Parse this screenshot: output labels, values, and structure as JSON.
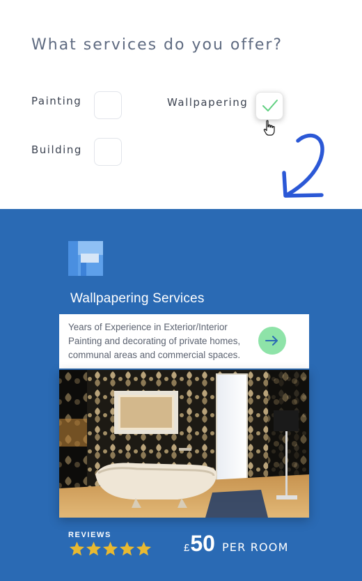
{
  "question": "What services do you offer?",
  "options": [
    {
      "label": "Painting",
      "checked": false
    },
    {
      "label": "Wallpapering",
      "checked": true
    },
    {
      "label": "Building",
      "checked": false
    }
  ],
  "colors": {
    "blue_background": "#2a6ab4",
    "check_mark": "#5fcf80",
    "go_button": "#8ee3a8",
    "arrow_accent": "#2b58d6",
    "star": "#e8b931"
  },
  "icons": {
    "check": "check-icon",
    "cursor": "hand-pointer-icon",
    "decorative_arrow": "curved-arrow-icon",
    "go": "arrow-right-icon",
    "star": "star-icon"
  },
  "service_card": {
    "title": "Wallpapering Services",
    "description": "Years of Experience in Exterior/Interior Painting and decorating of private homes, communal areas and commercial spaces.",
    "reviews_label": "REVIEWS",
    "rating": 5,
    "rating_max": 5,
    "price": {
      "currency": "£",
      "amount": "50",
      "unit": "PER ROOM"
    }
  }
}
